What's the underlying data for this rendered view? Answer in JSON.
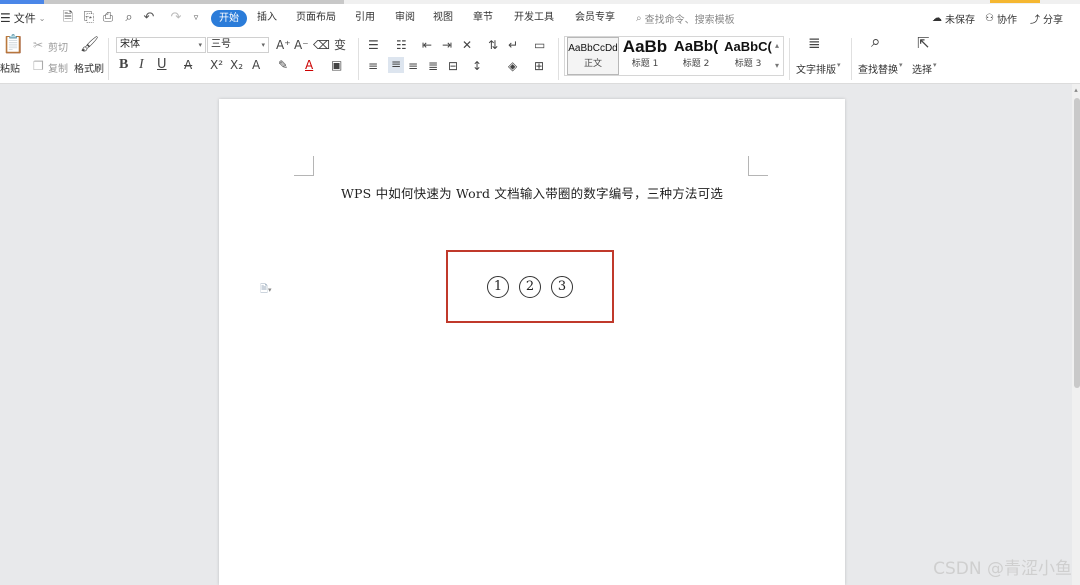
{
  "menubar": {
    "file_label": "文件",
    "tabs": [
      "开始",
      "插入",
      "页面布局",
      "引用",
      "审阅",
      "视图",
      "章节",
      "开发工具",
      "会员专享"
    ],
    "search_placeholder": "查找命令、搜索模板",
    "unsaved": "未保存",
    "collab": "协作",
    "share": "分享"
  },
  "ribbon": {
    "paste": "粘贴",
    "cut": "剪切",
    "copy": "复制",
    "format_painter": "格式刷",
    "font_name": "宋体",
    "font_size": "三号",
    "styles": [
      {
        "sample": "AaBbCcDd",
        "label": "正文"
      },
      {
        "sample": "AaBb",
        "label": "标题 1"
      },
      {
        "sample": "AaBb(",
        "label": "标题 2"
      },
      {
        "sample": "AaBbC(",
        "label": "标题 3"
      }
    ],
    "text_layout": "文字排版",
    "find_replace": "查找替换",
    "select": "选择"
  },
  "document": {
    "title": "WPS 中如何快速为 Word 文档输入带圈的数字编号，三种方法可选",
    "circled": [
      "1",
      "2",
      "3"
    ]
  },
  "watermark": "CSDN @青涩小鱼",
  "colors": {
    "accent": "#2b7cd9",
    "highlight_box": "#c0392b"
  }
}
